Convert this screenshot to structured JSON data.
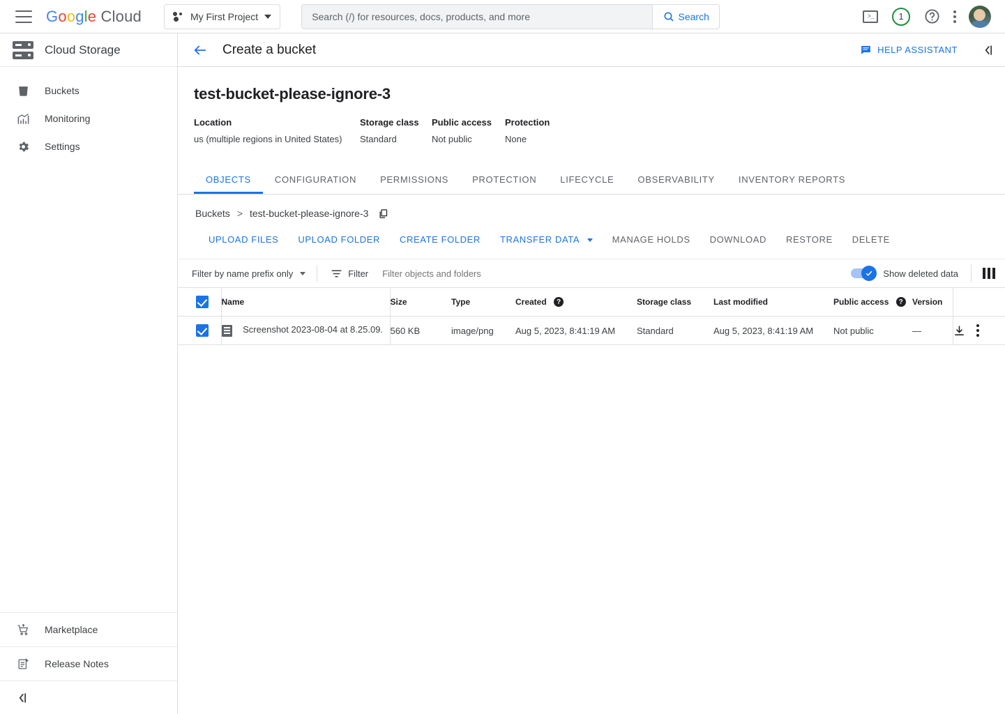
{
  "topbar": {
    "menu_icon": "hamburger-icon",
    "logo": {
      "google": "Google",
      "cloud": "Cloud"
    },
    "project": {
      "label": "My First Project"
    },
    "search": {
      "placeholder": "Search (/) for resources, docs, products, and more",
      "value": "",
      "button_label": "Search"
    },
    "terminal_label": ">_",
    "notifications_count": "1",
    "help_label": "?"
  },
  "sidenav": {
    "product_title": "Cloud Storage",
    "items": [
      {
        "label": "Buckets",
        "icon": "bucket-icon"
      },
      {
        "label": "Monitoring",
        "icon": "chart-icon"
      },
      {
        "label": "Settings",
        "icon": "gear-icon"
      }
    ],
    "bottom": [
      {
        "label": "Marketplace",
        "icon": "cart-icon"
      },
      {
        "label": "Release Notes",
        "icon": "release-notes-icon"
      }
    ]
  },
  "pagehead": {
    "title": "Create a bucket",
    "help_assistant": "HELP ASSISTANT"
  },
  "bucket": {
    "name": "test-bucket-please-ignore-3",
    "meta": [
      {
        "key": "Location",
        "value": "us (multiple regions in United States)"
      },
      {
        "key": "Storage class",
        "value": "Standard"
      },
      {
        "key": "Public access",
        "value": "Not public"
      },
      {
        "key": "Protection",
        "value": "None"
      }
    ]
  },
  "tabs": [
    {
      "label": "OBJECTS",
      "active": true
    },
    {
      "label": "CONFIGURATION",
      "active": false
    },
    {
      "label": "PERMISSIONS",
      "active": false
    },
    {
      "label": "PROTECTION",
      "active": false
    },
    {
      "label": "LIFECYCLE",
      "active": false
    },
    {
      "label": "OBSERVABILITY",
      "active": false
    },
    {
      "label": "INVENTORY REPORTS",
      "active": false
    }
  ],
  "breadcrumb": {
    "root": "Buckets",
    "separator": ">",
    "current": "test-bucket-please-ignore-3",
    "copy_icon": "copy-icon"
  },
  "actions": [
    {
      "label": "UPLOAD FILES",
      "enabled": true,
      "dropdown": false
    },
    {
      "label": "UPLOAD FOLDER",
      "enabled": true,
      "dropdown": false
    },
    {
      "label": "CREATE FOLDER",
      "enabled": true,
      "dropdown": false
    },
    {
      "label": "TRANSFER DATA",
      "enabled": true,
      "dropdown": true
    },
    {
      "label": "MANAGE HOLDS",
      "enabled": false,
      "dropdown": false
    },
    {
      "label": "DOWNLOAD",
      "enabled": false,
      "dropdown": false
    },
    {
      "label": "RESTORE",
      "enabled": false,
      "dropdown": false
    },
    {
      "label": "DELETE",
      "enabled": false,
      "dropdown": false
    }
  ],
  "filterbar": {
    "prefix_select": "Filter by name prefix only",
    "filter_label": "Filter",
    "filter_placeholder": "Filter objects and folders",
    "filter_value": "",
    "show_deleted_label": "Show deleted data",
    "show_deleted_on": true,
    "columns_icon": "column-settings-icon"
  },
  "table": {
    "columns": [
      {
        "label": "Name",
        "help": false
      },
      {
        "label": "Size",
        "help": false
      },
      {
        "label": "Type",
        "help": false
      },
      {
        "label": "Created",
        "help": true
      },
      {
        "label": "Storage class",
        "help": false
      },
      {
        "label": "Last modified",
        "help": false
      },
      {
        "label": "Public access",
        "help": true
      },
      {
        "label": "Version",
        "help": false
      }
    ],
    "header_checked": true,
    "rows": [
      {
        "checked": true,
        "name": "Screenshot 2023-08-04 at 8.25.09.",
        "size": "560 KB",
        "type": "image/png",
        "created": "Aug 5, 2023, 8:41:19 AM",
        "storage_class": "Standard",
        "last_modified": "Aug 5, 2023, 8:41:19 AM",
        "public_access": "Not public",
        "version": "—"
      }
    ]
  },
  "colors": {
    "accent": "#1a73e8",
    "text": "#3c4043",
    "muted": "#5f6368",
    "border": "#dadce0",
    "green": "#1e8e3e"
  }
}
